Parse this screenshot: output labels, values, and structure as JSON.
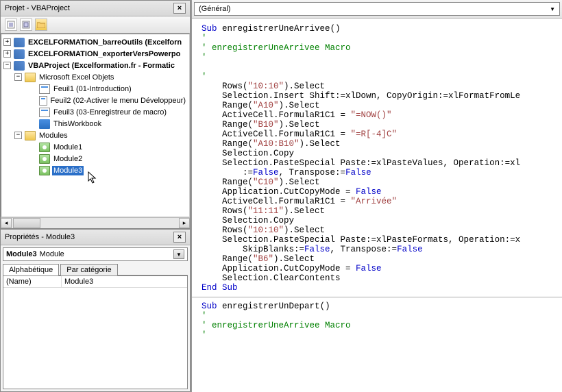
{
  "project_panel": {
    "title": "Projet - VBAProject",
    "tree": {
      "root1": "EXCELFORMATION_barreOutils (Excelforn",
      "root2": "EXCELFORMATION_exporterVersPowerpo",
      "root3": "VBAProject (Excelformation.fr - Formatic",
      "objects_folder": "Microsoft Excel Objets",
      "sheets": [
        "Feuil1 (01-Introduction)",
        "Feuil2 (02-Activer le menu Développeur)",
        "Feuil3 (03-Enregistreur de macro)",
        "ThisWorkbook"
      ],
      "modules_folder": "Modules",
      "modules": [
        "Module1",
        "Module2",
        "Module3"
      ]
    }
  },
  "properties_panel": {
    "title": "Propriétés - Module3",
    "object_name": "Module3",
    "object_type": "Module",
    "tabs": {
      "alpha": "Alphabétique",
      "cat": "Par catégorie"
    },
    "rows": [
      {
        "name": "(Name)",
        "value": "Module3"
      }
    ]
  },
  "code_panel": {
    "dropdown": "(Général)",
    "sub1_name": "enregistrerUneArrivee",
    "comment1": "enregistrerUneArrivee Macro",
    "lines": {
      "l1a": "    Rows(",
      "l1b": "\"10:10\"",
      "l1c": ").Select",
      "l2a": "    Selection.Insert Shift:=xlDown, CopyOrigin:=xlFormatFromLe",
      "l3a": "    Range(",
      "l3b": "\"A10\"",
      "l3c": ").Select",
      "l4a": "    ActiveCell.FormulaR1C1 = ",
      "l4b": "\"=NOW()\"",
      "l5a": "    Range(",
      "l5b": "\"B10\"",
      "l5c": ").Select",
      "l6a": "    ActiveCell.FormulaR1C1 = ",
      "l6b": "\"=R[-4]C\"",
      "l7a": "    Range(",
      "l7b": "\"A10:B10\"",
      "l7c": ").Select",
      "l8": "    Selection.Copy",
      "l9": "    Selection.PasteSpecial Paste:=xlPasteValues, Operation:=xl",
      "l10a": "        :=",
      "l10b": "False",
      "l10c": ", Transpose:=",
      "l10d": "False",
      "l11a": "    Range(",
      "l11b": "\"C10\"",
      "l11c": ").Select",
      "l12a": "    Application.CutCopyMode = ",
      "l12b": "False",
      "l13a": "    ActiveCell.FormulaR1C1 = ",
      "l13b": "\"Arrivée\"",
      "l14a": "    Rows(",
      "l14b": "\"11:11\"",
      "l14c": ").Select",
      "l15": "    Selection.Copy",
      "l16a": "    Rows(",
      "l16b": "\"10:10\"",
      "l16c": ").Select",
      "l17": "    Selection.PasteSpecial Paste:=xlPasteFormats, Operation:=x",
      "l18a": "        SkipBlanks:=",
      "l18b": "False",
      "l18c": ", Transpose:=",
      "l18d": "False",
      "l19a": "    Range(",
      "l19b": "\"B6\"",
      "l19c": ").Select",
      "l20a": "    Application.CutCopyMode = ",
      "l20b": "False",
      "l21": "    Selection.ClearContents",
      "sub2_name": "enregistrerUnDepart",
      "comment2": "enregistrerUneArrivee Macro"
    }
  }
}
